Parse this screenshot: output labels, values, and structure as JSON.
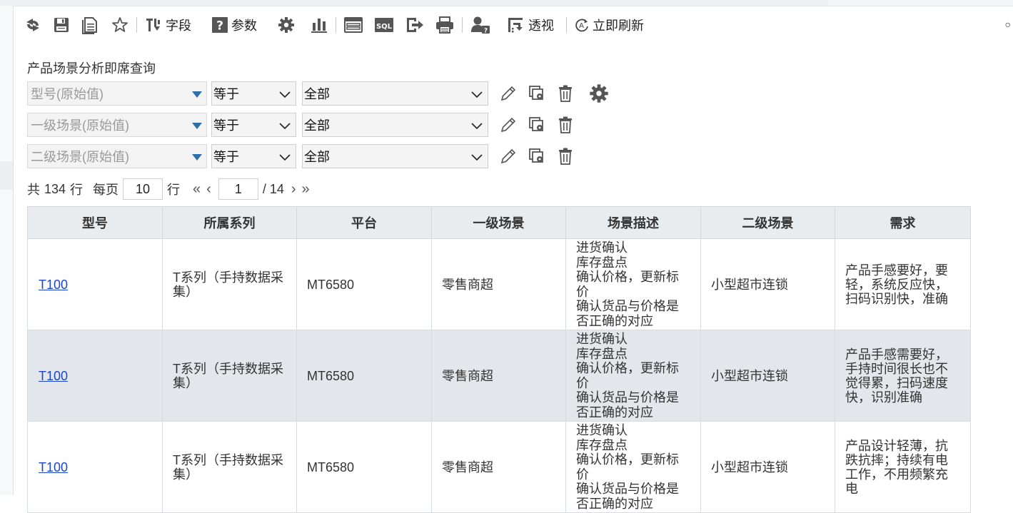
{
  "toolbar": {
    "field_label": "字段",
    "param_label": "参数",
    "pivot_label": "透视",
    "refresh_label": "立即刷新",
    "sql_text": "SQL"
  },
  "query": {
    "title": "产品场景分析即席查询",
    "filters": [
      {
        "field": "型号(原始值)",
        "operator": "等于",
        "value": "全部"
      },
      {
        "field": "一级场景(原始值)",
        "operator": "等于",
        "value": "全部"
      },
      {
        "field": "二级场景(原始值)",
        "operator": "等于",
        "value": "全部"
      }
    ]
  },
  "pager": {
    "total_prefix": "共",
    "total": "134",
    "total_suffix": "行",
    "per_page_label": "每页",
    "per_page": "10",
    "per_page_suffix": "行",
    "current_page": "1",
    "total_pages": "/ 14"
  },
  "table": {
    "headers": [
      "型号",
      "所属系列",
      "平台",
      "一级场景",
      "场景描述",
      "二级场景",
      "需求"
    ],
    "rows": [
      {
        "model": "T100",
        "series": "T系列（手持数据采集）",
        "platform": "MT6580",
        "scene1": "零售商超",
        "desc": [
          "进货确认",
          "库存盘点",
          "确认价格，更新标价",
          "确认货品与价格是否正确的对应"
        ],
        "scene2": "小型超市连锁",
        "need": "产品手感要好，要轻，系统反应快，扫码识别快，准确"
      },
      {
        "model": "T100",
        "series": "T系列（手持数据采集）",
        "platform": "MT6580",
        "scene1": "零售商超",
        "desc": [
          "进货确认",
          "库存盘点",
          "确认价格，更新标价",
          "确认货品与价格是否正确的对应"
        ],
        "scene2": "小型超市连锁",
        "need": "产品手感需要好，手持时间很长也不觉得累，扫码速度快，识别准确"
      },
      {
        "model": "T100",
        "series": "T系列（手持数据采集）",
        "platform": "MT6580",
        "scene1": "零售商超",
        "desc": [
          "进货确认",
          "库存盘点",
          "确认价格，更新标价",
          "确认货品与价格是否正确的对应"
        ],
        "scene2": "小型超市连锁",
        "need": "产品设计轻薄，抗跌抗摔；持续有电工作，不用频繁充电"
      }
    ]
  },
  "colors": {
    "link": "#1a47c9",
    "header_bg": "#e9ecef",
    "alt_row_bg": "#e3e6ea",
    "field_arrow": "#2f6ea7",
    "icon_gray": "#555555"
  },
  "icons": [
    "refresh-icon",
    "save-icon",
    "save-as-icon",
    "favorite-star-icon",
    "field-icon",
    "param-help-icon",
    "settings-gear-icon",
    "bar-chart-icon",
    "layout-icon",
    "sql-icon",
    "export-icon",
    "print-icon",
    "user-permission-icon",
    "pivot-icon",
    "auto-refresh-icon"
  ]
}
